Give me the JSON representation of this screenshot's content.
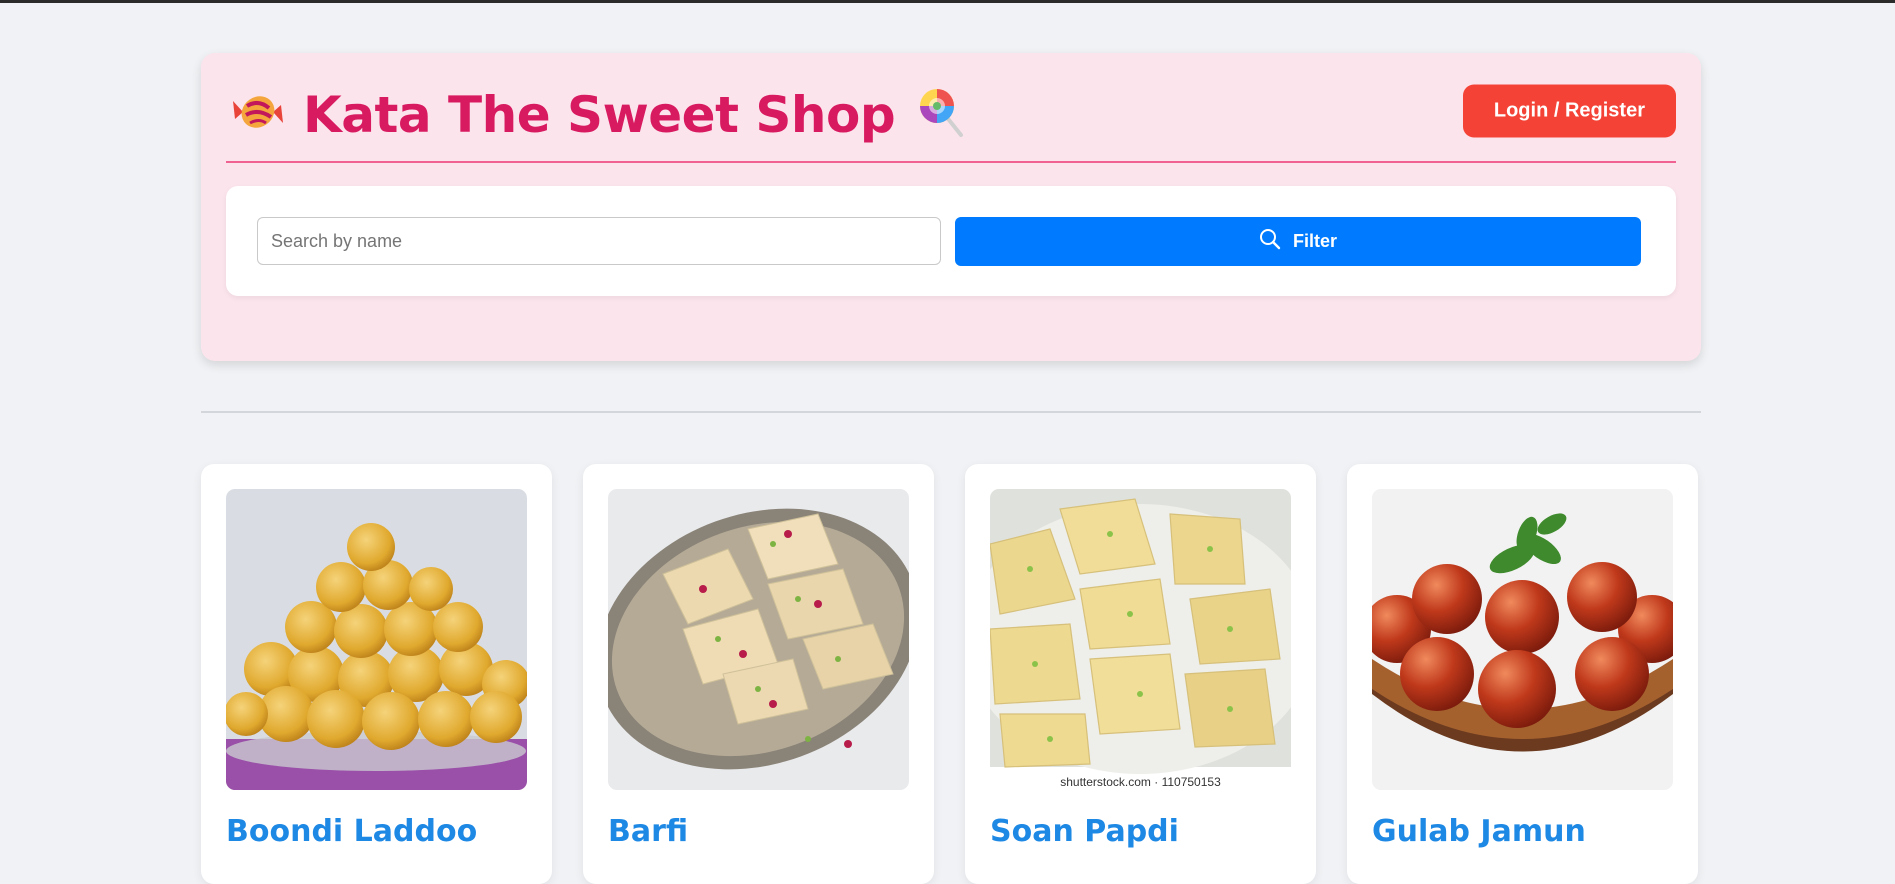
{
  "header": {
    "title": "Kata The Sweet Shop",
    "left_icon": "candy-icon",
    "right_icon": "lollipop-icon",
    "login_label": "Login / Register"
  },
  "search": {
    "placeholder": "Search by name",
    "value": "",
    "filter_label": "Filter",
    "filter_icon": "search-icon"
  },
  "sweets": [
    {
      "name": "Boondi Laddoo"
    },
    {
      "name": "Barfi"
    },
    {
      "name": "Soan Papdi",
      "caption": "shutterstock.com · 110750153"
    },
    {
      "name": "Gulab Jamun"
    }
  ],
  "colors": {
    "page_bg": "#f0f2f5",
    "header_bg": "#fce4ec",
    "title": "#d81b60",
    "login_button": "#f44336",
    "filter_button": "#007bff",
    "card_title": "#1e88e5"
  }
}
